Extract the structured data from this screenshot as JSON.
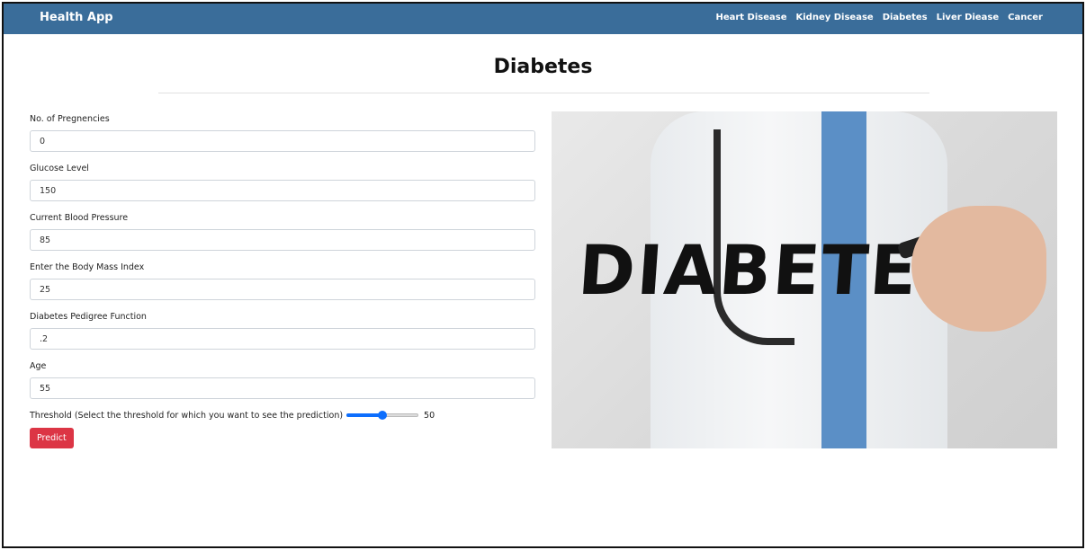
{
  "navbar": {
    "brand": "Health App",
    "links": [
      "Heart Disease",
      "Kidney Disease",
      "Diabetes",
      "Liver Diease",
      "Cancer"
    ]
  },
  "page": {
    "title": "Diabetes"
  },
  "form": {
    "fields": [
      {
        "label": "No. of Pregnencies",
        "value": "0"
      },
      {
        "label": "Glucose Level",
        "value": "150"
      },
      {
        "label": "Current Blood Pressure",
        "value": "85"
      },
      {
        "label": "Enter the Body Mass Index",
        "value": "25"
      },
      {
        "label": "Diabetes Pedigree Function",
        "value": ".2"
      },
      {
        "label": "Age",
        "value": "55"
      }
    ],
    "threshold": {
      "label": "Threshold (Select the threshold for which you want to see the prediction)",
      "value": "50",
      "min": 0,
      "max": 100
    },
    "predict_label": "Predict"
  },
  "hero": {
    "word": "DIABETES"
  },
  "colors": {
    "navbar": "#3a6d9a",
    "predict": "#dc3545",
    "slider": "#0d6efd"
  }
}
